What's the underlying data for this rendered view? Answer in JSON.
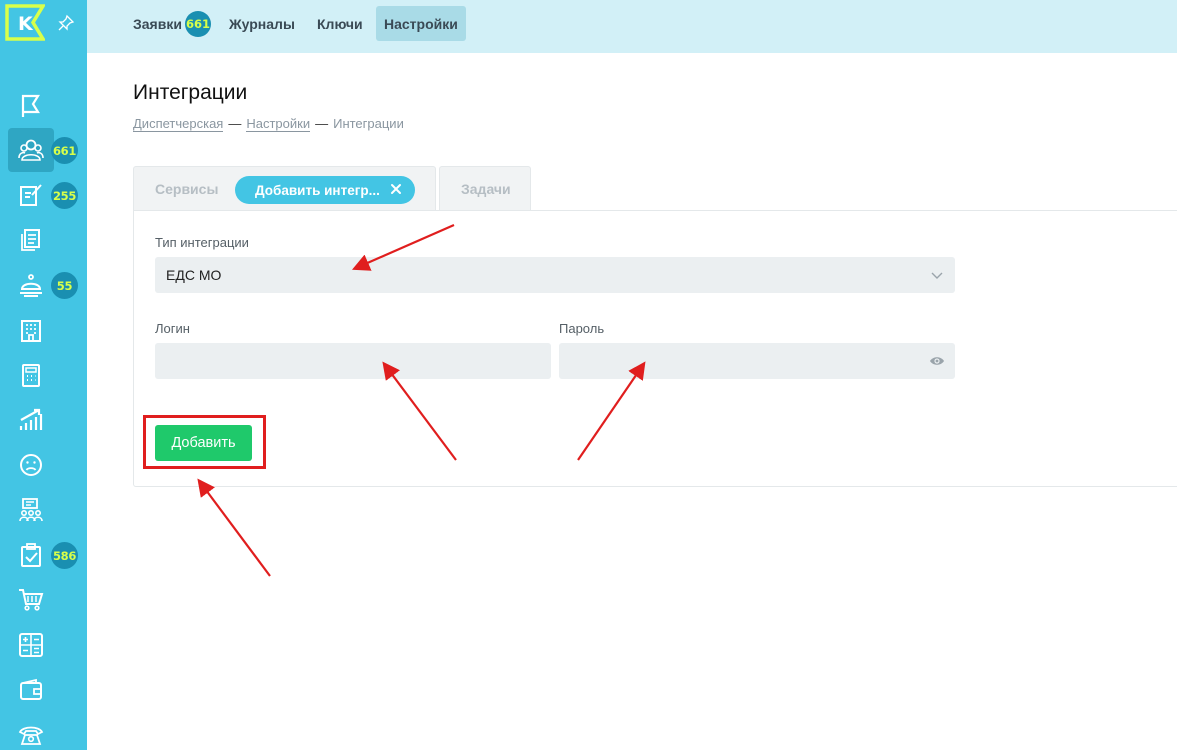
{
  "topbar": {
    "tabs": [
      {
        "label": "Заявки",
        "badge": "661"
      },
      {
        "label": "Журналы"
      },
      {
        "label": "Ключи"
      },
      {
        "label": "Настройки"
      }
    ]
  },
  "sidebar": {
    "logo": "K",
    "items": [
      {
        "icon": "flag-icon"
      },
      {
        "icon": "users-icon",
        "badge": "661"
      },
      {
        "icon": "edit-note-icon",
        "badge": "255"
      },
      {
        "icon": "documents-icon"
      },
      {
        "icon": "service-bell-icon",
        "badge": "55"
      },
      {
        "icon": "building-icon"
      },
      {
        "icon": "calculator-icon"
      },
      {
        "icon": "chart-growth-icon"
      },
      {
        "icon": "sad-face-icon"
      },
      {
        "icon": "presentation-group-icon"
      },
      {
        "icon": "clipboard-check-icon",
        "badge": "586"
      },
      {
        "icon": "cart-icon"
      },
      {
        "icon": "math-calculator-icon"
      },
      {
        "icon": "wallet-icon"
      },
      {
        "icon": "phone-icon"
      }
    ]
  },
  "page": {
    "title": "Интеграции",
    "breadcrumb": [
      "Диспетчерская",
      "Настройки",
      "Интеграции"
    ],
    "breadcrumb_separator": "—"
  },
  "content_tabs": {
    "services": "Сервисы",
    "add_integration": "Добавить интегр...",
    "tasks": "Задачи"
  },
  "form": {
    "integration_type_label": "Тип интеграции",
    "integration_type_value": "ЕДС МО",
    "login_label": "Логин",
    "login_value": "",
    "password_label": "Пароль",
    "password_value": "",
    "add_button": "Добавить"
  },
  "colors": {
    "sidebar": "#43c5e4",
    "topbar": "#d2f0f7",
    "badge": "#1a8fb1",
    "badge_text": "#d8ff4a",
    "add_button": "#1fc96b",
    "annotation": "#e01e1e"
  }
}
